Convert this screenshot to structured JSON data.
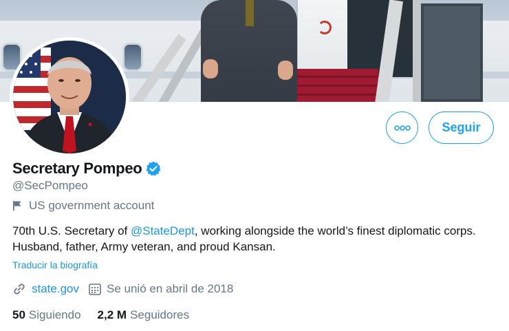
{
  "colors": {
    "accent": "#1da1f2",
    "link": "#1b95e0",
    "text_primary": "#14171a",
    "text_secondary": "#657786",
    "verified_badge": "#1da1f2"
  },
  "profile": {
    "display_name": "Secretary Pompeo",
    "verified_icon": "verified-badge-icon",
    "handle": "@SecPompeo",
    "account_label_icon": "flag-icon",
    "account_label": "US government account",
    "bio": {
      "part1": "70th U.S. Secretary of ",
      "mention": "@StateDept",
      "part2": ", working alongside the world’s finest diplomatic corps. Husband, father, Army veteran, and proud Kansan."
    },
    "translate_bio": "Traducir la biografía",
    "website_icon": "link-icon",
    "website": "state.gov",
    "joined_icon": "calendar-icon",
    "joined": "Se unió en abril de 2018"
  },
  "stats": {
    "following_count": "50",
    "following_label": "Siguiendo",
    "followers_count": "2,2 M",
    "followers_label": "Seguidores"
  },
  "actions": {
    "more_icon": "more-options-icon",
    "follow_label": "Seguir"
  }
}
